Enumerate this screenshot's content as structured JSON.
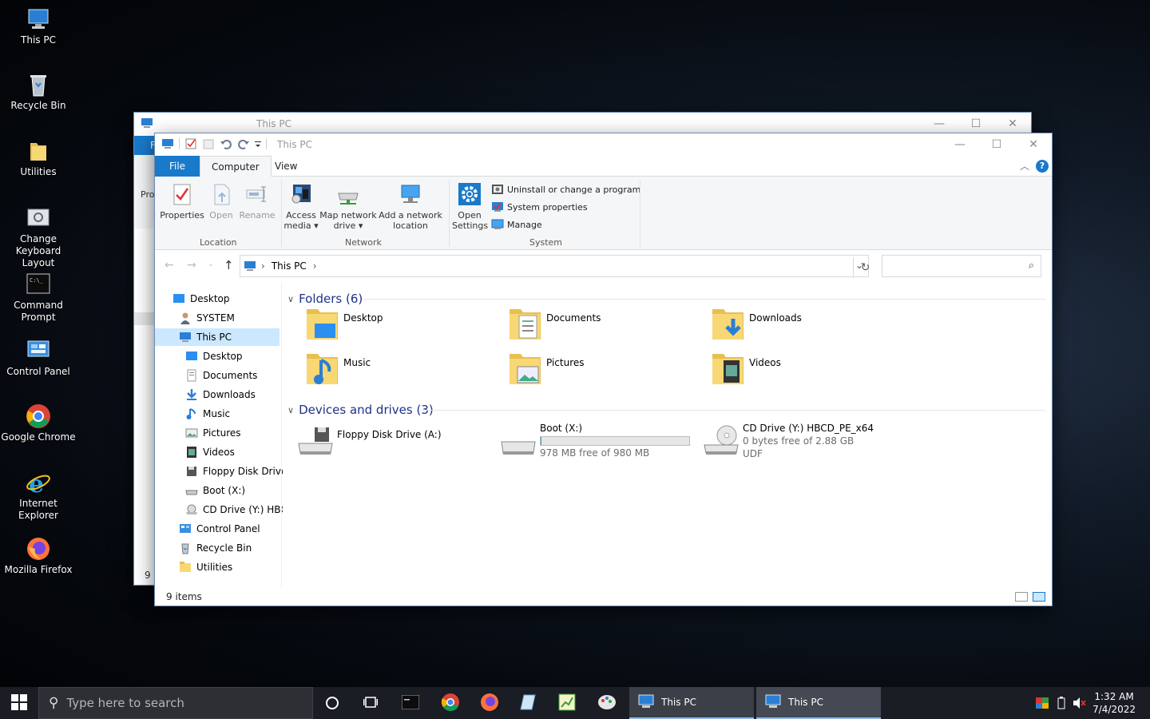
{
  "desktop": {
    "icons": [
      {
        "label": "This PC",
        "icon": "this-pc-icon"
      },
      {
        "label": "Recycle Bin",
        "icon": "recycle-bin-icon"
      },
      {
        "label": "Utilities",
        "icon": "folder-icon"
      },
      {
        "label": "Change Keyboard Layout",
        "icon": "keyboard-layout-icon"
      },
      {
        "label": "Command Prompt",
        "icon": "command-prompt-icon"
      },
      {
        "label": "Control Panel",
        "icon": "control-panel-icon"
      },
      {
        "label": "Google Chrome",
        "icon": "chrome-icon"
      },
      {
        "label": "Internet Explorer",
        "icon": "internet-explorer-icon"
      },
      {
        "label": "Mozilla Firefox",
        "icon": "firefox-icon"
      }
    ]
  },
  "back_window": {
    "title": "This PC",
    "file_tab": "F",
    "pro_fragment": "Pro",
    "status_fragment": "9 i"
  },
  "window": {
    "title": "This PC",
    "controls": {
      "minimize": "—",
      "maximize": "☐",
      "close": "✕"
    },
    "tabs": {
      "file": "File",
      "computer": "Computer",
      "view": "View"
    },
    "ribbon": {
      "location": {
        "label": "Location",
        "properties": "Properties",
        "open": "Open",
        "rename": "Rename"
      },
      "network": {
        "label": "Network",
        "access_media": "Access media",
        "map_network_drive": "Map network drive",
        "add_network_location": "Add a network location"
      },
      "system": {
        "label": "System",
        "open_settings": "Open Settings",
        "uninstall": "Uninstall or change a program",
        "system_properties": "System properties",
        "manage": "Manage"
      }
    },
    "address": {
      "path": "This PC",
      "search_placeholder": ""
    },
    "nav": [
      {
        "label": "Desktop",
        "level": 0
      },
      {
        "label": "SYSTEM",
        "level": 1
      },
      {
        "label": "This PC",
        "level": 1,
        "selected": true
      },
      {
        "label": "Desktop",
        "level": 2
      },
      {
        "label": "Documents",
        "level": 2
      },
      {
        "label": "Downloads",
        "level": 2
      },
      {
        "label": "Music",
        "level": 2
      },
      {
        "label": "Pictures",
        "level": 2
      },
      {
        "label": "Videos",
        "level": 2
      },
      {
        "label": "Floppy Disk Drive",
        "level": 2
      },
      {
        "label": "Boot (X:)",
        "level": 2
      },
      {
        "label": "CD Drive (Y:) HBC",
        "level": 2
      },
      {
        "label": "Control Panel",
        "level": 1
      },
      {
        "label": "Recycle Bin",
        "level": 1
      },
      {
        "label": "Utilities",
        "level": 1
      }
    ],
    "folders_header": "Folders (6)",
    "folders": [
      "Desktop",
      "Documents",
      "Downloads",
      "Music",
      "Pictures",
      "Videos"
    ],
    "devices_header": "Devices and drives (3)",
    "drives": [
      {
        "name": "Floppy Disk Drive (A:)",
        "detail": "",
        "fs": ""
      },
      {
        "name": "Boot (X:)",
        "detail": "978 MB free of 980 MB",
        "fs": "",
        "used_fraction": 0.002
      },
      {
        "name": "CD Drive (Y:) HBCD_PE_x64",
        "detail": "0 bytes free of 2.88 GB",
        "fs": "UDF"
      }
    ],
    "status": "9 items"
  },
  "taskbar": {
    "search_placeholder": "Type here to search",
    "windows": [
      "This PC",
      "This PC"
    ],
    "time": "1:32 AM",
    "date": "7/4/2022"
  },
  "colors": {
    "accent": "#1979ca",
    "selection": "#cce8ff",
    "section": "#1e3287"
  }
}
